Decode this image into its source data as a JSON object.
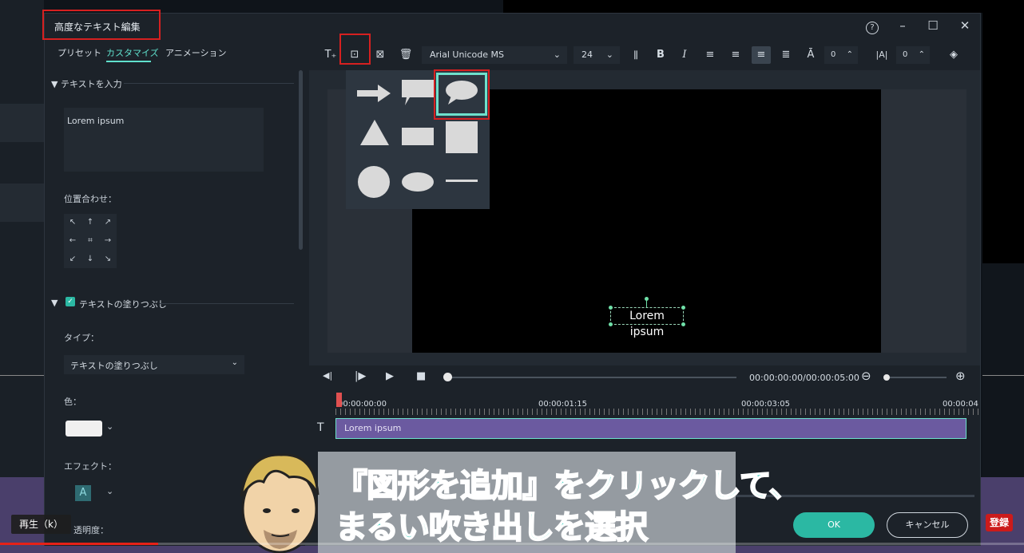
{
  "dialog": {
    "title": "高度なテキスト編集",
    "window_controls": {
      "help": "?",
      "minimize": "–",
      "maximize": "☐",
      "close": "✕"
    }
  },
  "tabs": [
    {
      "label": "プリセット",
      "active": false
    },
    {
      "label": "カスタマイズ",
      "active": true
    },
    {
      "label": "アニメーション",
      "active": false
    }
  ],
  "left_panel": {
    "text_section": "テキストを入力",
    "text_value": "Lorem ipsum",
    "align_label": "位置合わせ：",
    "fill_section": "テキストの塗りつぶし",
    "fill_checked": true,
    "type_label": "タイプ：",
    "type_value": "テキストの塗りつぶし",
    "color_label": "色：",
    "color_value": "#f0f0f0",
    "effect_label": "エフェクト：",
    "effect_glyph": "A",
    "opacity_label": "透明度："
  },
  "toolbar": {
    "font": "Arial Unicode MS",
    "size": "24",
    "bold": "B",
    "italic": "I",
    "char_spacing": "0",
    "line_spacing": "0"
  },
  "shape_menu": {
    "shapes": [
      "arrow",
      "rectangle-callout",
      "round-speech-bubble",
      "triangle",
      "rectangle",
      "square",
      "circle",
      "ellipse",
      "line"
    ],
    "selected": "round-speech-bubble"
  },
  "preview": {
    "text": "Lorem ipsum"
  },
  "playback": {
    "time": "00:00:00:00/00:00:05:00"
  },
  "timeline": {
    "ruler_labels": [
      "00:00:00:00",
      "00:00:01:15",
      "00:00:03:05",
      "00:00:04"
    ],
    "clip_label": "Lorem ipsum",
    "track_icon": "T"
  },
  "buttons": {
    "ok": "OK",
    "cancel": "キャンセル"
  },
  "overlay": {
    "subtitle_line1": "『図形を追加』をクリックして、",
    "subtitle_line2": "まるい吹き出しを選択",
    "play_tooltip": "再生（k）",
    "subscribe": "登録"
  },
  "colors": {
    "accent": "#5fe0cc",
    "highlight_red": "#d62020",
    "ok_button": "#2bb8a3",
    "clip": "#6b5aa0"
  }
}
